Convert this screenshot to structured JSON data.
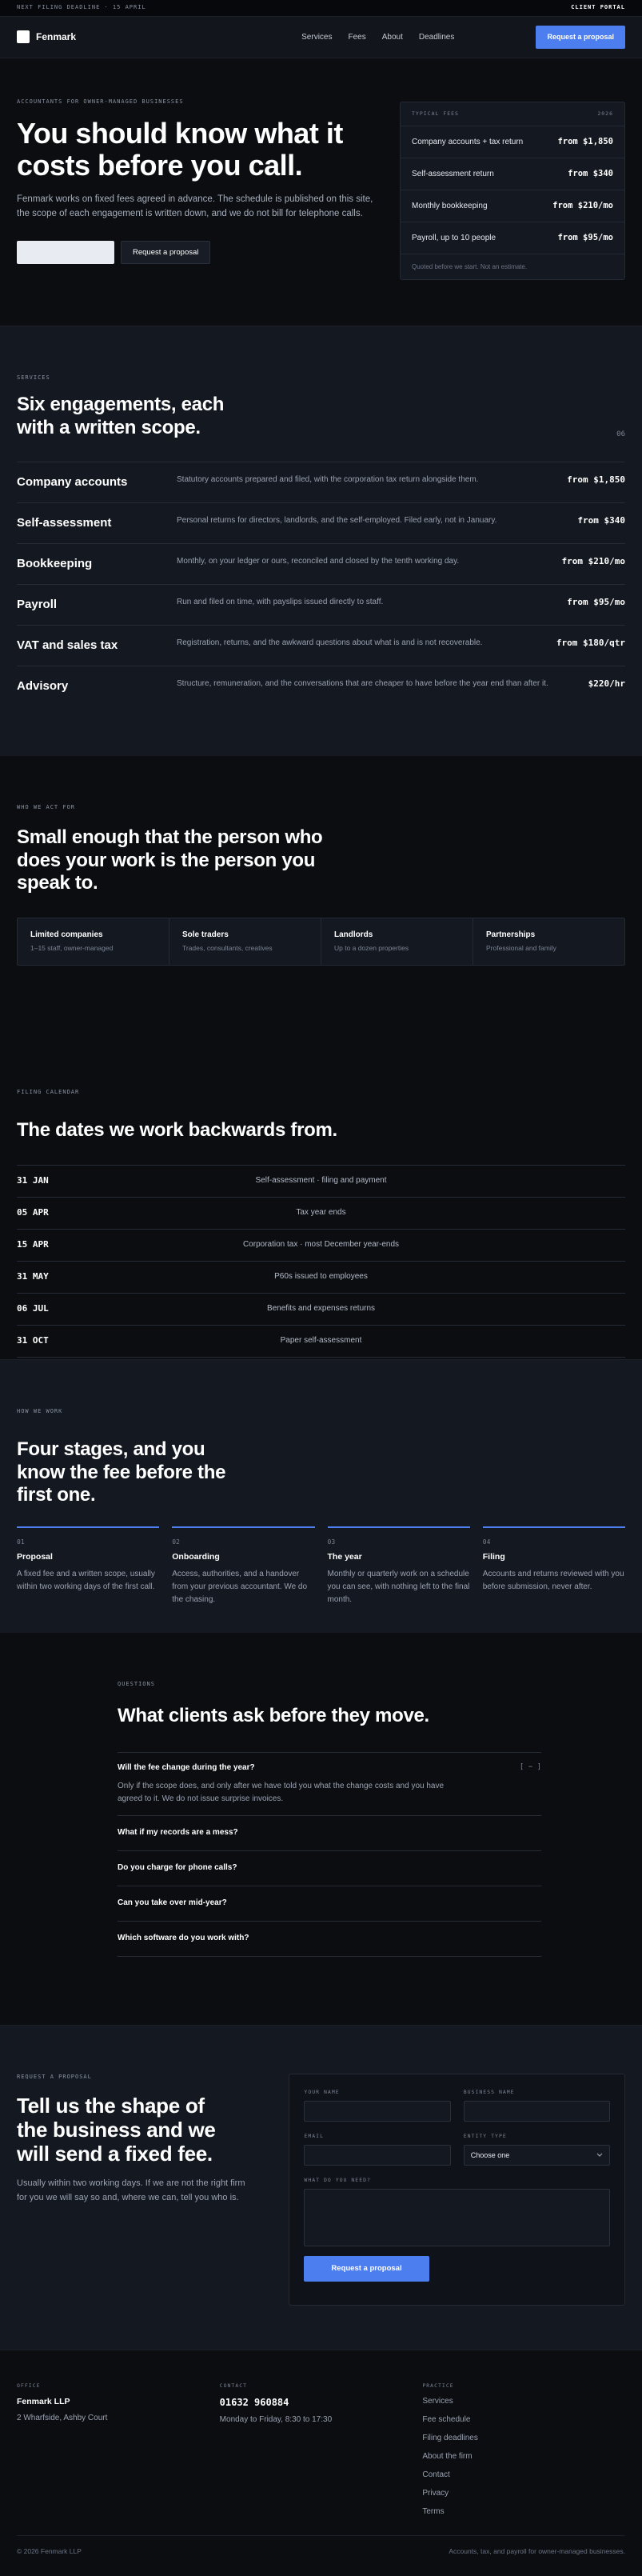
{
  "topbar": {
    "deadline": "NEXT FILING DEADLINE · 15 APRIL",
    "portal": "CLIENT PORTAL"
  },
  "nav": {
    "brand": "Fenmark",
    "links": [
      "Services",
      "Fees",
      "About",
      "Deadlines"
    ],
    "cta": "Request a proposal"
  },
  "hero": {
    "eyebrow": "ACCOUNTANTS FOR OWNER-MANAGED BUSINESSES",
    "title": "You should know what it costs before you call.",
    "body": "Fenmark works on fixed fees agreed in advance. The schedule is published on this site, the scope of each engagement is written down, and we do not bill for telephone calls.",
    "secondary_btn": "Request a proposal"
  },
  "fees_card": {
    "head_left": "TYPICAL FEES",
    "head_right": "2026",
    "rows": [
      {
        "name": "Company accounts + tax return",
        "price": "from $1,850"
      },
      {
        "name": "Self-assessment return",
        "price": "from $340"
      },
      {
        "name": "Monthly bookkeeping",
        "price": "from $210/mo"
      },
      {
        "name": "Payroll, up to 10 people",
        "price": "from $95/mo"
      }
    ],
    "foot": "Quoted before we start. Not an estimate."
  },
  "services": {
    "eyebrow": "SERVICES",
    "title": "Six engagements, each with a written scope.",
    "count": "06",
    "items": [
      {
        "name": "Company accounts",
        "desc": "Statutory accounts prepared and filed, with the corporation tax return alongside them.",
        "price": "from $1,850"
      },
      {
        "name": "Self-assessment",
        "desc": "Personal returns for directors, landlords, and the self-employed. Filed early, not in January.",
        "price": "from $340"
      },
      {
        "name": "Bookkeeping",
        "desc": "Monthly, on your ledger or ours, reconciled and closed by the tenth working day.",
        "price": "from $210/mo"
      },
      {
        "name": "Payroll",
        "desc": "Run and filed on time, with payslips issued directly to staff.",
        "price": "from $95/mo"
      },
      {
        "name": "VAT and sales tax",
        "desc": "Registration, returns, and the awkward questions about what is and is not recoverable.",
        "price": "from $180/qtr"
      },
      {
        "name": "Advisory",
        "desc": "Structure, remuneration, and the conversations that are cheaper to have before the year end than after it.",
        "price": "$220/hr"
      }
    ]
  },
  "who": {
    "eyebrow": "WHO WE ACT FOR",
    "title": "Small enough that the person who does your work is the person you speak to.",
    "cells": [
      {
        "title": "Limited companies",
        "desc": "1–15 staff, owner-managed"
      },
      {
        "title": "Sole traders",
        "desc": "Trades, consultants, creatives"
      },
      {
        "title": "Landlords",
        "desc": "Up to a dozen properties"
      },
      {
        "title": "Partnerships",
        "desc": "Professional and family"
      }
    ]
  },
  "calendar": {
    "eyebrow": "FILING CALENDAR",
    "title": "The dates we work backwards from.",
    "rows": [
      {
        "date": "31 JAN",
        "event": "Self-assessment · filing and payment"
      },
      {
        "date": "05 APR",
        "event": "Tax year ends"
      },
      {
        "date": "15 APR",
        "event": "Corporation tax · most December year-ends"
      },
      {
        "date": "31 MAY",
        "event": "P60s issued to employees"
      },
      {
        "date": "06 JUL",
        "event": "Benefits and expenses returns"
      },
      {
        "date": "31 OCT",
        "event": "Paper self-assessment"
      }
    ]
  },
  "stages": {
    "eyebrow": "HOW WE WORK",
    "title": "Four stages, and you know the fee before the first one.",
    "items": [
      {
        "num": "01",
        "name": "Proposal",
        "desc": "A fixed fee and a written scope, usually within two working days of the first call."
      },
      {
        "num": "02",
        "name": "Onboarding",
        "desc": "Access, authorities, and a handover from your previous accountant. We do the chasing."
      },
      {
        "num": "03",
        "name": "The year",
        "desc": "Monthly or quarterly work on a schedule you can see, with nothing left to the final month."
      },
      {
        "num": "04",
        "name": "Filing",
        "desc": "Accounts and returns reviewed with you before submission, never after."
      }
    ]
  },
  "faq": {
    "eyebrow": "QUESTIONS",
    "title": "What clients ask before they move.",
    "open": {
      "q": "Will the fee change during the year?",
      "toggle": "[ − ]",
      "a": "Only if the scope does, and only after we have told you what the change costs and you have agreed to it. We do not issue surprise invoices."
    },
    "items": [
      "What if my records are a mess?",
      "Do you charge for phone calls?",
      "Can you take over mid-year?",
      "Which software do you work with?"
    ]
  },
  "request": {
    "eyebrow": "REQUEST A PROPOSAL",
    "title": "Tell us the shape of the business and we will send a fixed fee.",
    "body": "Usually within two working days. If we are not the right firm for you we will say so and, where we can, tell you who is.",
    "labels": {
      "name": "YOUR NAME",
      "business": "BUSINESS NAME",
      "email": "EMAIL",
      "entity": "ENTITY TYPE",
      "need": "WHAT DO YOU NEED?"
    },
    "entity_value": "Choose one",
    "submit": "Request a proposal"
  },
  "footer": {
    "office_head": "OFFICE",
    "office_name": "Fenmark LLP",
    "office_addr": "2 Wharfside, Ashby Court",
    "contact_head": "CONTACT",
    "phone": "01632 960884",
    "hours": "Monday to Friday, 8:30 to 17:30",
    "practice_head": "PRACTICE",
    "links": [
      "Services",
      "Fee schedule",
      "Filing deadlines",
      "About the firm",
      "Contact",
      "Privacy",
      "Terms"
    ],
    "copyright": "© 2026 Fenmark LLP",
    "tagline": "Accounts, tax, and payroll for owner-managed businesses."
  }
}
